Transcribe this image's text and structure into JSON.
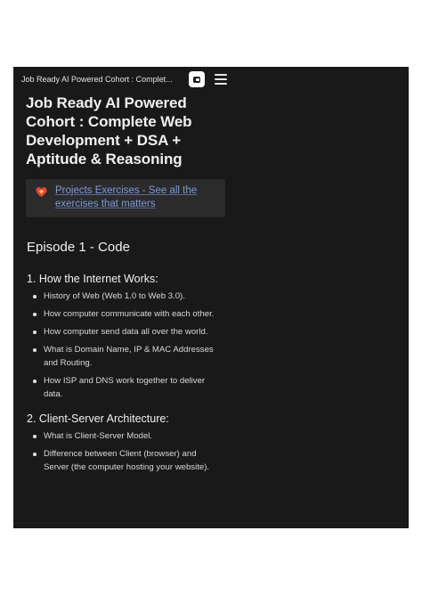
{
  "topbar": {
    "tab_title": "Job Ready AI Powered Cohort : Complet...",
    "square_icon": "window-icon",
    "menu_icon": "hamburger-menu-icon"
  },
  "page": {
    "title": "Job Ready AI Powered Cohort : Complete Web Development + DSA + Aptitude & Reasoning"
  },
  "callout": {
    "icon": "heart-icon",
    "link_text": "Projects Exercises - See all the exercises that matters"
  },
  "episode": {
    "heading": "Episode 1 - Code"
  },
  "sections": [
    {
      "heading": "1. How the Internet Works:",
      "items": [
        "History of Web (Web 1.0 to Web 3.0).",
        "How computer communicate with each other.",
        "How computer send data all over the world.",
        "What is Domain Name, IP & MAC Addresses and Routing.",
        "How ISP and DNS work together to deliver data."
      ]
    },
    {
      "heading": "2. Client-Server Architecture:",
      "items": [
        "What is Client-Server Model.",
        "Difference between Client (browser) and Server (the computer hosting your website)."
      ]
    }
  ],
  "colors": {
    "background": "#191919",
    "link": "#7d9ad8",
    "callout_bg": "#2b2b2b"
  }
}
